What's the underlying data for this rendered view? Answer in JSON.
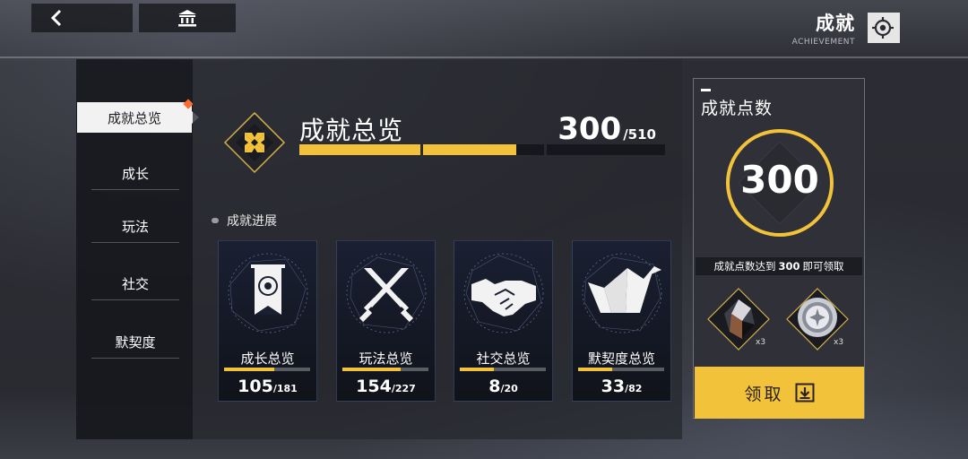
{
  "header": {
    "title": "成就",
    "subtitle": "ACHIEVEMENT"
  },
  "sidebar": {
    "items": [
      {
        "label": "成就总览",
        "active": true
      },
      {
        "label": "成长"
      },
      {
        "label": "玩法"
      },
      {
        "label": "社交"
      },
      {
        "label": "默契度"
      }
    ]
  },
  "overview": {
    "title": "成就总览",
    "current": "300",
    "total": "/510",
    "progress": 0.588
  },
  "progress_section": {
    "label": "成就进展",
    "cards": [
      {
        "label": "成长总览",
        "current": "105",
        "total": "/181",
        "icon": "banner-emblem-icon"
      },
      {
        "label": "玩法总览",
        "current": "154",
        "total": "/227",
        "icon": "crossed-swords-icon"
      },
      {
        "label": "社交总览",
        "current": "8",
        "total": "/20",
        "icon": "handshake-icon"
      },
      {
        "label": "默契度总览",
        "current": "33",
        "total": "/82",
        "icon": "paper-crane-icon"
      }
    ]
  },
  "points_panel": {
    "title": "成就点数",
    "points": "300",
    "note_prefix": "成就点数达到",
    "note_value": "300",
    "note_suffix": "即可领取",
    "rewards": [
      {
        "icon": "crystal-item-icon",
        "qty": "x3"
      },
      {
        "icon": "silver-medal-icon",
        "qty": "x3"
      }
    ],
    "claim_label": "领取"
  },
  "colors": {
    "accent": "#f2c23a",
    "notification": "#ff6a2e"
  }
}
